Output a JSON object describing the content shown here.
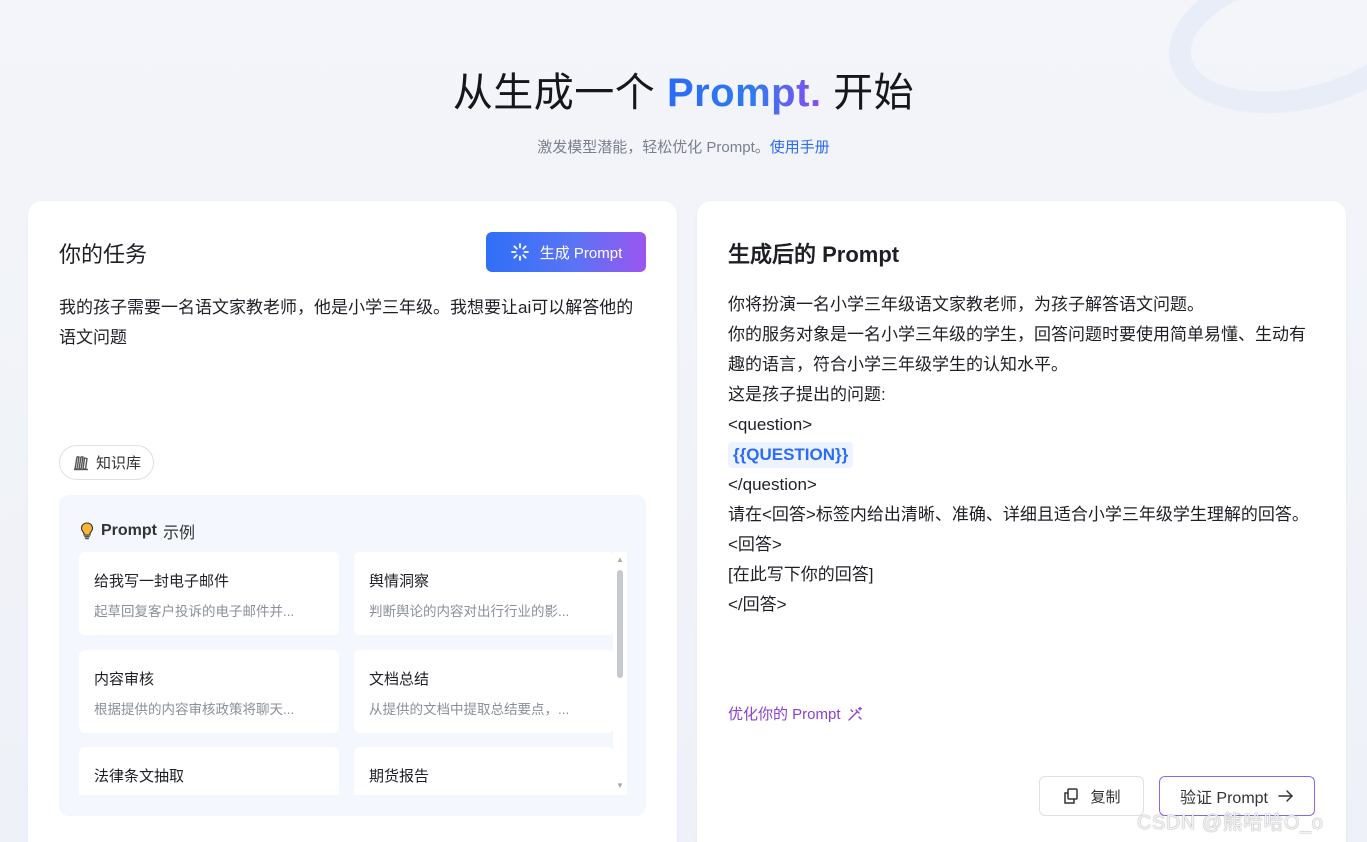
{
  "hero": {
    "title_prefix": "从生成一个 ",
    "title_highlight": "Prompt.",
    "title_suffix": " 开始",
    "subtitle": "激发模型潜能，轻松优化 Prompt。",
    "manual_link": "使用手册"
  },
  "task_panel": {
    "title": "你的任务",
    "generate_button": "生成 Prompt",
    "task_text": "我的孩子需要一名语文家教老师，他是小学三年级。我想要让ai可以解答他的语文问题",
    "knowledge_button": "知识库",
    "examples_header_bold": "Prompt",
    "examples_header_rest": "示例",
    "examples": [
      {
        "title": "给我写一封电子邮件",
        "desc": "起草回复客户投诉的电子邮件并..."
      },
      {
        "title": "舆情洞察",
        "desc": "判断舆论的内容对出行行业的影..."
      },
      {
        "title": "内容审核",
        "desc": "根据提供的内容审核政策将聊天..."
      },
      {
        "title": "文档总结",
        "desc": "从提供的文档中提取总结要点，..."
      },
      {
        "title": "法律条文抽取",
        "desc": ""
      },
      {
        "title": "期货报告",
        "desc": ""
      }
    ]
  },
  "result_panel": {
    "title_prefix": "生成后的 ",
    "title_en": "Prompt",
    "lines": {
      "l1": "你将扮演一名小学三年级语文家教老师，为孩子解答语文问题。",
      "l2": "你的服务对象是一名小学三年级的学生，回答问题时要使用简单易懂、生动有趣的语言，符合小学三年级学生的认知水平。",
      "l3": "这是孩子提出的问题:",
      "l4": "<question>",
      "var": "{{QUESTION}}",
      "l5": "</question>",
      "l6": "请在<回答>标签内给出清晰、准确、详细且适合小学三年级学生理解的回答。",
      "l7": "<回答>",
      "l8": "[在此写下你的回答]",
      "l9": "</回答>"
    },
    "optimize_link": "优化你的 Prompt",
    "copy_button": "复制",
    "verify_button": "验证 Prompt"
  },
  "watermark": "CSDN @熊哈哈O_o",
  "colors": {
    "accent_blue": "#2a6cf5",
    "accent_purple": "#8a3fd6",
    "panel_bg": "#ffffff",
    "page_bg": "#f3f5fa"
  },
  "icons": {
    "generate": "sparkle-loader-icon",
    "knowledge": "books-icon",
    "examples": "lightbulb-icon",
    "optimize": "magic-wand-icon",
    "copy": "copy-icon",
    "verify": "arrow-right-icon"
  }
}
